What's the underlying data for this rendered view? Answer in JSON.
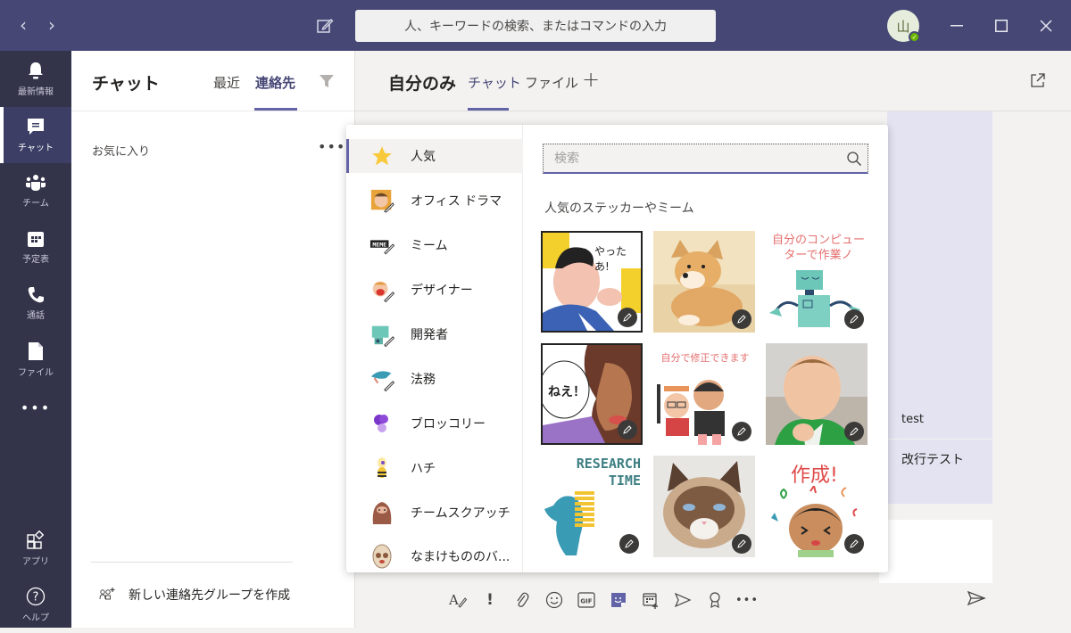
{
  "titlebar": {
    "back_icon": "chevron-left-icon",
    "forward_icon": "chevron-right-icon",
    "compose_icon": "compose-icon",
    "search_placeholder": "人、キーワードの検索、またはコマンドの入力",
    "avatar_initial": "山",
    "presence_status": "available",
    "presence_color": "#6bb700"
  },
  "rail": {
    "items": [
      {
        "label": "最新情報",
        "icon": "bell-icon"
      },
      {
        "label": "チャット",
        "icon": "chat-icon",
        "active": true
      },
      {
        "label": "チーム",
        "icon": "teams-icon"
      },
      {
        "label": "予定表",
        "icon": "calendar-icon"
      },
      {
        "label": "通話",
        "icon": "phone-icon"
      },
      {
        "label": "ファイル",
        "icon": "file-icon"
      },
      {
        "label": "…",
        "icon": "more-icon"
      }
    ],
    "bottom": [
      {
        "label": "アプリ",
        "icon": "apps-icon"
      },
      {
        "label": "ヘルプ",
        "icon": "help-icon"
      }
    ]
  },
  "list_pane": {
    "title": "チャット",
    "tabs": [
      {
        "label": "最近"
      },
      {
        "label": "連絡先",
        "active": true
      }
    ],
    "filter_icon": "filter-icon",
    "favorites_label": "お気に入り",
    "more_label": "•••",
    "new_group_label": "新しい連絡先グループを作成"
  },
  "main": {
    "title": "自分のみ",
    "tabs": [
      {
        "label": "チャット",
        "active": true
      },
      {
        "label": "ファイル"
      }
    ],
    "add_tab_label": "+",
    "messages": [
      {
        "text": "test"
      },
      {
        "text": "改行テスト"
      }
    ]
  },
  "sticker_picker": {
    "categories": [
      {
        "label": "人気",
        "icon": "star-icon",
        "active": true
      },
      {
        "label": "オフィス ドラマ",
        "icon": "office-drama-icon"
      },
      {
        "label": "ミーム",
        "icon": "meme-icon"
      },
      {
        "label": "デザイナー",
        "icon": "designer-icon"
      },
      {
        "label": "開発者",
        "icon": "developer-icon"
      },
      {
        "label": "法務",
        "icon": "legal-icon"
      },
      {
        "label": "ブロッコリー",
        "icon": "broccoli-icon"
      },
      {
        "label": "ハチ",
        "icon": "bee-icon"
      },
      {
        "label": "チームスクアッチ",
        "icon": "squatch-icon"
      },
      {
        "label": "なまけもののバ...",
        "icon": "sloth-icon"
      }
    ],
    "search_placeholder": "検索",
    "section_title": "人気のステッカーやミーム",
    "stickers": [
      {
        "name": "comic-man-sticker",
        "caption": "やったあ!"
      },
      {
        "name": "doge-sticker",
        "caption": ""
      },
      {
        "name": "robot-sticker",
        "caption": "自分のコンピューターで作業ノ"
      },
      {
        "name": "comic-woman-sticker",
        "caption": "ねえ！"
      },
      {
        "name": "fix-it-sticker",
        "caption": "自分で修正できます"
      },
      {
        "name": "success-kid-sticker",
        "caption": ""
      },
      {
        "name": "research-time-sticker",
        "caption": "RESEARCH TIME"
      },
      {
        "name": "grumpy-cat-sticker",
        "caption": ""
      },
      {
        "name": "create-sticker",
        "caption": "作成!"
      }
    ]
  },
  "compose_toolbar": {
    "buttons": [
      {
        "name": "format-icon"
      },
      {
        "name": "important-icon"
      },
      {
        "name": "attach-icon"
      },
      {
        "name": "emoji-icon"
      },
      {
        "name": "gif-icon",
        "label": "GIF"
      },
      {
        "name": "sticker-icon",
        "active": true
      },
      {
        "name": "meeting-icon"
      },
      {
        "name": "stream-icon"
      },
      {
        "name": "praise-icon"
      },
      {
        "name": "more-icon",
        "label": "•••"
      }
    ],
    "send_icon": "send-icon"
  },
  "colors": {
    "brand": "#464775",
    "accent": "#6264a7",
    "rail": "#33344a"
  }
}
